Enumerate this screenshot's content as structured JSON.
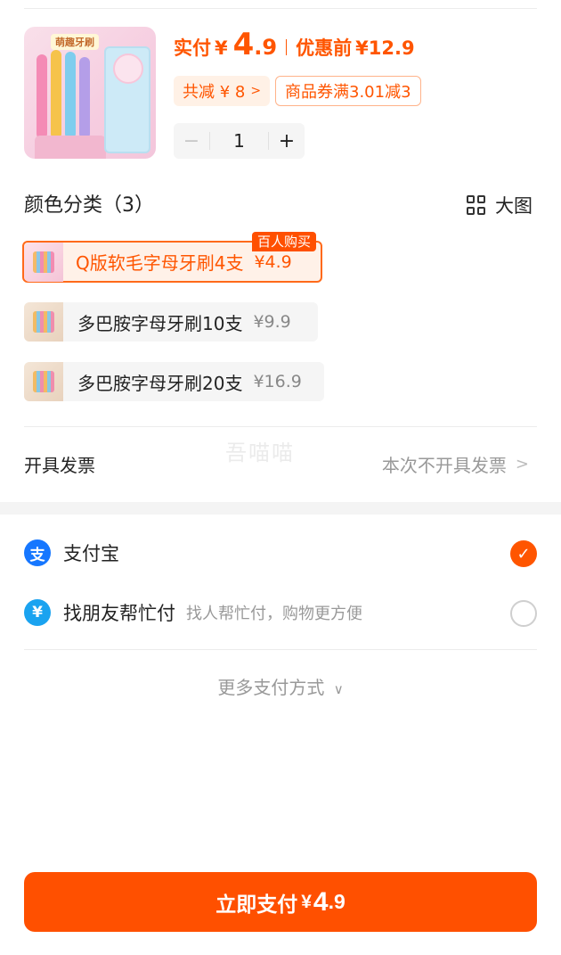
{
  "product": {
    "image_text": "萌趣牙刷",
    "price_label": "实付",
    "currency": "¥",
    "price_int": "4",
    "price_dec": ".9",
    "original_label": "优惠前",
    "original_price": "¥12.9",
    "discount_chip": "共减 ¥ 8",
    "coupon_chip": "商品券满3.01减3",
    "quantity": "1",
    "minus": "−",
    "plus": "+"
  },
  "colors": {
    "section_title": "颜色分类（3）",
    "big_image_label": "大图",
    "hot_tag": "百人购买",
    "options": [
      {
        "name": "Q版软毛字母牙刷4支",
        "price": "¥4.9",
        "selected": true
      },
      {
        "name": "多巴胺字母牙刷10支",
        "price": "¥9.9",
        "selected": false
      },
      {
        "name": "多巴胺字母牙刷20支",
        "price": "¥16.9",
        "selected": false
      }
    ]
  },
  "invoice": {
    "label": "开具发票",
    "value": "本次不开具发票",
    "watermark": "吾喵喵"
  },
  "payment": {
    "methods": [
      {
        "name": "支付宝",
        "icon": "alipay-icon",
        "selected": true
      },
      {
        "name": "找朋友帮忙付",
        "desc": "找人帮忙付，购物更方便",
        "icon": "friend-pay-icon",
        "selected": false
      }
    ],
    "more_label": "更多支付方式"
  },
  "pay_button": {
    "label": "立即支付",
    "currency": "¥",
    "amount_int": "4",
    "amount_dec": ".9"
  },
  "colors_theme": {
    "accent": "#ff5500",
    "button": "#ff5000",
    "alipay": "#1677ff"
  }
}
